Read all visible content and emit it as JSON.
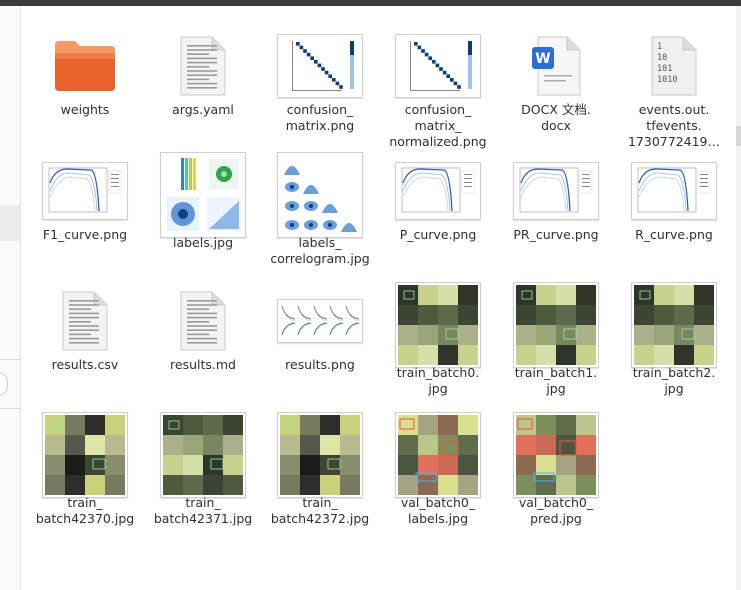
{
  "files": [
    {
      "name": "weights",
      "icon": "folder-icon",
      "kind": "folder"
    },
    {
      "name": "args.yaml",
      "icon": "text-document-icon",
      "kind": "text"
    },
    {
      "name": "confusion_\nmatrix.png",
      "icon": "confusion-matrix-thumbnail",
      "kind": "matrix"
    },
    {
      "name": "confusion_\nmatrix_\nnormalized.png",
      "icon": "confusion-matrix-normalized-thumbnail",
      "kind": "matrix"
    },
    {
      "name": "DOCX 文档.\ndocx",
      "icon": "word-document-icon",
      "kind": "docx",
      "badge": "W"
    },
    {
      "name": "events.out.\ntfevents.\n1730772419…",
      "icon": "binary-file-icon",
      "kind": "binary",
      "binary_lines": [
        "1",
        "10",
        "101",
        "1010"
      ]
    },
    {
      "name": "F1_curve.png",
      "icon": "f1-curve-thumbnail",
      "kind": "curve"
    },
    {
      "name": "labels.jpg",
      "icon": "labels-thumbnail",
      "kind": "labels"
    },
    {
      "name": "labels_\ncorrelogram.jpg",
      "icon": "labels-correlogram-thumbnail",
      "kind": "correlogram"
    },
    {
      "name": "P_curve.png",
      "icon": "p-curve-thumbnail",
      "kind": "curve"
    },
    {
      "name": "PR_curve.png",
      "icon": "pr-curve-thumbnail",
      "kind": "curve"
    },
    {
      "name": "R_curve.png",
      "icon": "r-curve-thumbnail",
      "kind": "curve"
    },
    {
      "name": "results.csv",
      "icon": "text-document-icon",
      "kind": "text"
    },
    {
      "name": "results.md",
      "icon": "text-document-icon",
      "kind": "text"
    },
    {
      "name": "results.png",
      "icon": "results-thumbnail",
      "kind": "results"
    },
    {
      "name": "train_batch0.\njpg",
      "icon": "train-batch-thumbnail",
      "kind": "mosaic"
    },
    {
      "name": "train_batch1.\njpg",
      "icon": "train-batch-thumbnail",
      "kind": "mosaic"
    },
    {
      "name": "train_batch2.\njpg",
      "icon": "train-batch-thumbnail",
      "kind": "mosaic"
    },
    {
      "name": "train_\nbatch42370.jpg",
      "icon": "train-batch-thumbnail",
      "kind": "mosaic-dark"
    },
    {
      "name": "train_\nbatch42371.jpg",
      "icon": "train-batch-thumbnail",
      "kind": "mosaic"
    },
    {
      "name": "train_\nbatch42372.jpg",
      "icon": "train-batch-thumbnail",
      "kind": "mosaic-dark"
    },
    {
      "name": "val_batch0_\nlabels.jpg",
      "icon": "val-batch-thumbnail",
      "kind": "mosaic-val"
    },
    {
      "name": "val_batch0_\npred.jpg",
      "icon": "val-batch-thumbnail",
      "kind": "mosaic-val"
    }
  ],
  "colors": {
    "folder": "#e8622e",
    "folder_light": "#f59a63",
    "docx_blue": "#2b6fd6",
    "curve_blue": "#2e5fb8",
    "matrix_blue": "#0b3d7a"
  }
}
